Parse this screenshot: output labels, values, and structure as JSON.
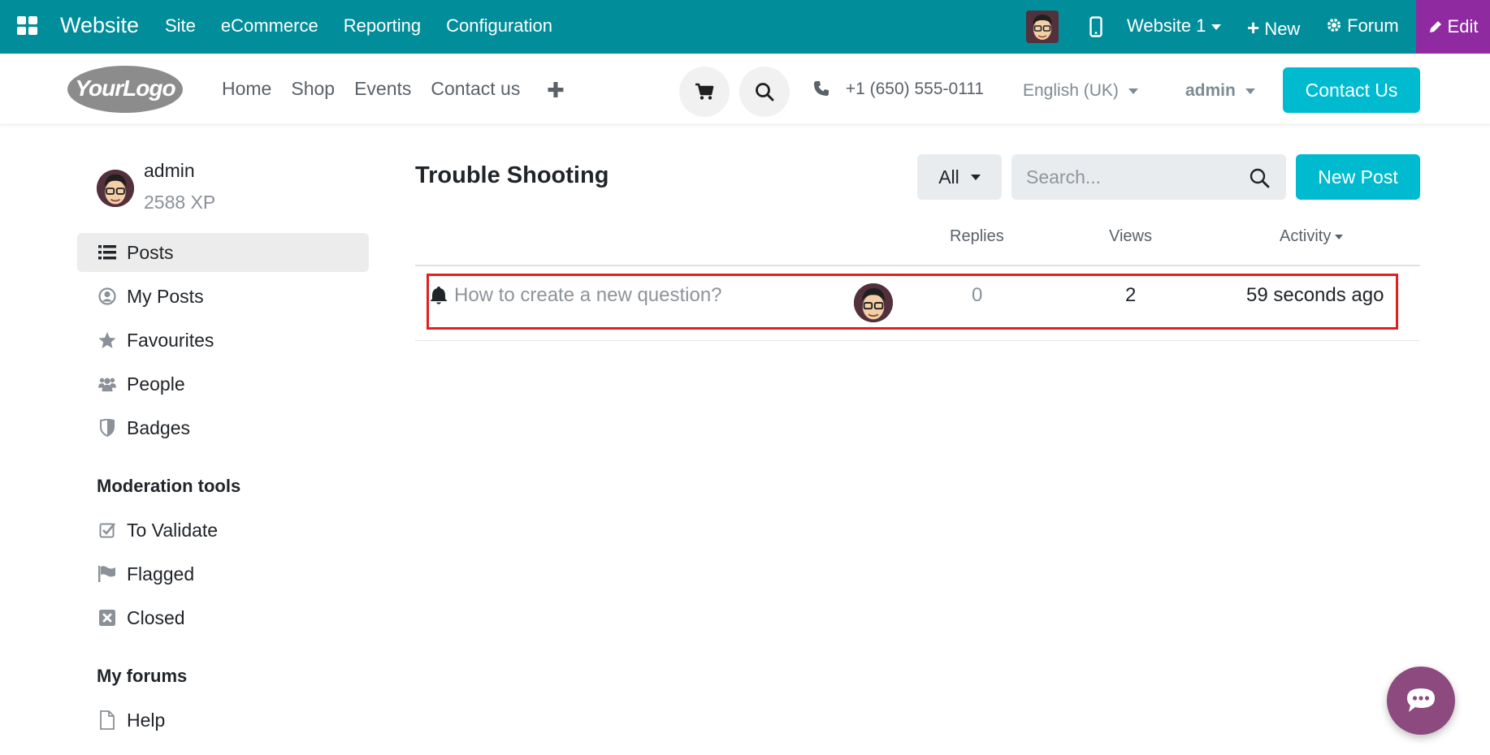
{
  "adminbar": {
    "app_name": "Website",
    "menu": [
      "Site",
      "eCommerce",
      "Reporting",
      "Configuration"
    ],
    "website_selector": "Website 1",
    "new_label": "New",
    "forum_label": "Forum",
    "edit_label": "Edit",
    "bg_color": "#018d9a",
    "edit_color": "#8f2aa1"
  },
  "header": {
    "logo_text": "YourLogo",
    "nav": [
      "Home",
      "Shop",
      "Events",
      "Contact us"
    ],
    "phone": "+1 (650) 555-0111",
    "language": "English (UK)",
    "user": "admin",
    "contact_button": "Contact Us",
    "accent_color": "#00bbcf"
  },
  "sidebar": {
    "profile": {
      "name": "admin",
      "xp": "2588 XP"
    },
    "items": [
      {
        "label": "Posts",
        "icon": "list-icon",
        "active": true
      },
      {
        "label": "My Posts",
        "icon": "user-circle-icon",
        "active": false
      },
      {
        "label": "Favourites",
        "icon": "star-icon",
        "active": false
      },
      {
        "label": "People",
        "icon": "people-icon",
        "active": false
      },
      {
        "label": "Badges",
        "icon": "shield-icon",
        "active": false
      }
    ],
    "moderation_heading": "Moderation tools",
    "moderation_items": [
      {
        "label": "To Validate",
        "icon": "check-square-icon"
      },
      {
        "label": "Flagged",
        "icon": "flag-icon"
      },
      {
        "label": "Closed",
        "icon": "close-square-icon"
      }
    ],
    "forums_heading": "My forums",
    "forums_items": [
      {
        "label": "Help",
        "icon": "file-icon"
      }
    ]
  },
  "main": {
    "title": "Trouble Shooting",
    "filter": "All",
    "search_placeholder": "Search...",
    "new_post_button": "New Post",
    "columns": {
      "replies": "Replies",
      "views": "Views",
      "activity": "Activity"
    },
    "posts": [
      {
        "title": "How to create a new question?",
        "replies": "0",
        "views": "2",
        "activity": "59 seconds ago"
      }
    ]
  }
}
